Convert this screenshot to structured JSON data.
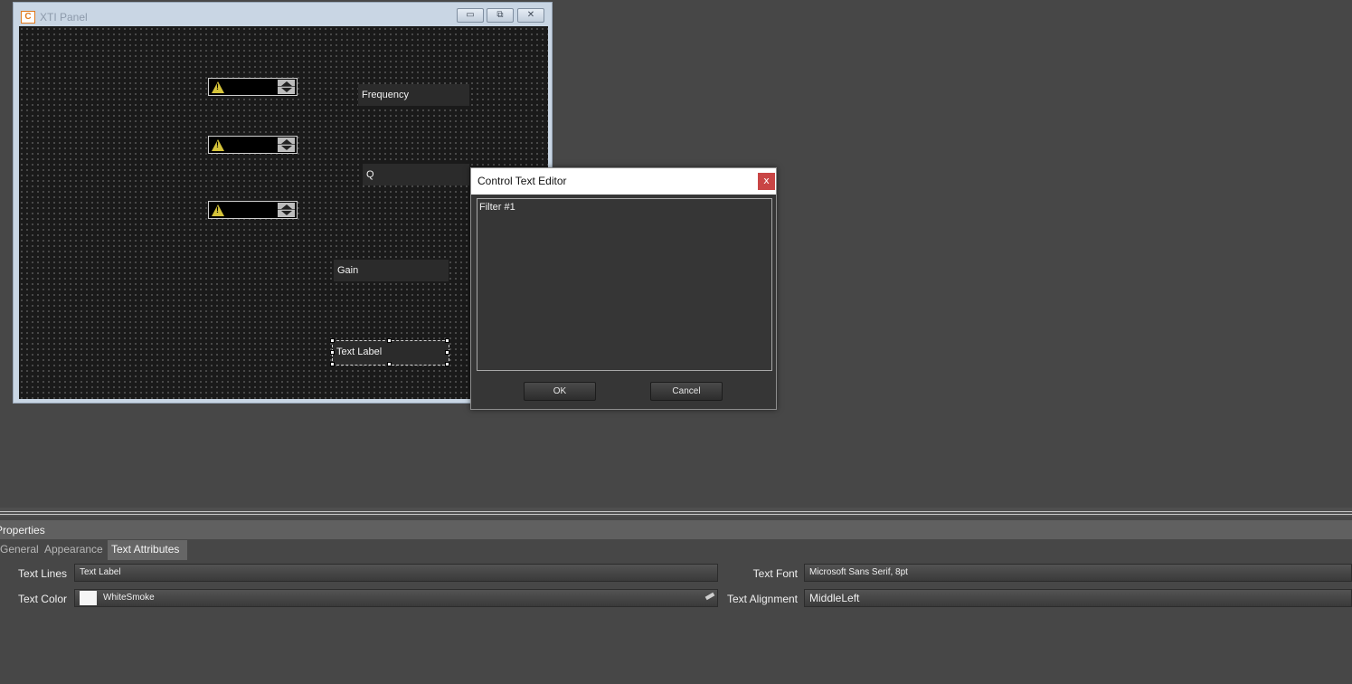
{
  "panel_window": {
    "title": "XTI Panel",
    "icon_letter": "C",
    "minimize": "▭",
    "restore": "⧉",
    "close": "✕"
  },
  "canvas": {
    "labels": {
      "frequency": "Frequency",
      "q": "Q",
      "gain": "Gain",
      "selected": "Text Label"
    }
  },
  "dialog": {
    "title": "Control Text Editor",
    "close": "x",
    "text": "Filter #1",
    "ok": "OK",
    "cancel": "Cancel"
  },
  "properties": {
    "title": "Properties",
    "tabs": [
      "General",
      "Appearance",
      "Text Attributes"
    ],
    "active_tab": "Text Attributes",
    "text_lines_label": "Text Lines",
    "text_lines_value": "Text Label",
    "text_color_label": "Text Color",
    "text_color_value": "WhiteSmoke",
    "text_color_swatch": "#F5F5F5",
    "text_font_label": "Text Font",
    "text_font_value": "Microsoft Sans Serif, 8pt",
    "text_alignment_label": "Text Alignment",
    "text_alignment_value": "MiddleLeft"
  },
  "colors": {
    "background": "#474747",
    "close_button": "#c94545",
    "warning": "#d5c33a"
  }
}
